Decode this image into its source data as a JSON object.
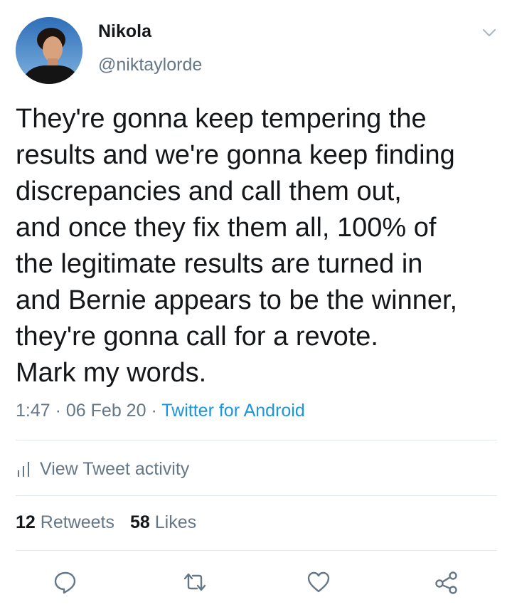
{
  "author": {
    "name": "Nikola",
    "handle": "@niktaylorde"
  },
  "tweet": {
    "lines": [
      "They're gonna keep tempering the",
      "results and we're gonna keep finding",
      "discrepancies and call them out,",
      "and once they fix them all, 100% of",
      "the legitimate results are turned in",
      "and Bernie appears to be the winner,",
      "they're gonna call for a revote.",
      "Mark my words."
    ]
  },
  "meta": {
    "time": "1:47",
    "date": "06 Feb 20",
    "separator": "·",
    "source": "Twitter for Android"
  },
  "activity": {
    "label": "View Tweet activity"
  },
  "stats": {
    "retweets_count": "12",
    "retweets_label": "Retweets",
    "likes_count": "58",
    "likes_label": "Likes"
  },
  "actions": {
    "icons": [
      "reply-icon",
      "retweet-icon",
      "like-icon",
      "share-icon"
    ]
  },
  "colors": {
    "text": "#14171a",
    "secondary": "#657786",
    "link": "#1b95e0",
    "divider": "#e1e8ed"
  }
}
